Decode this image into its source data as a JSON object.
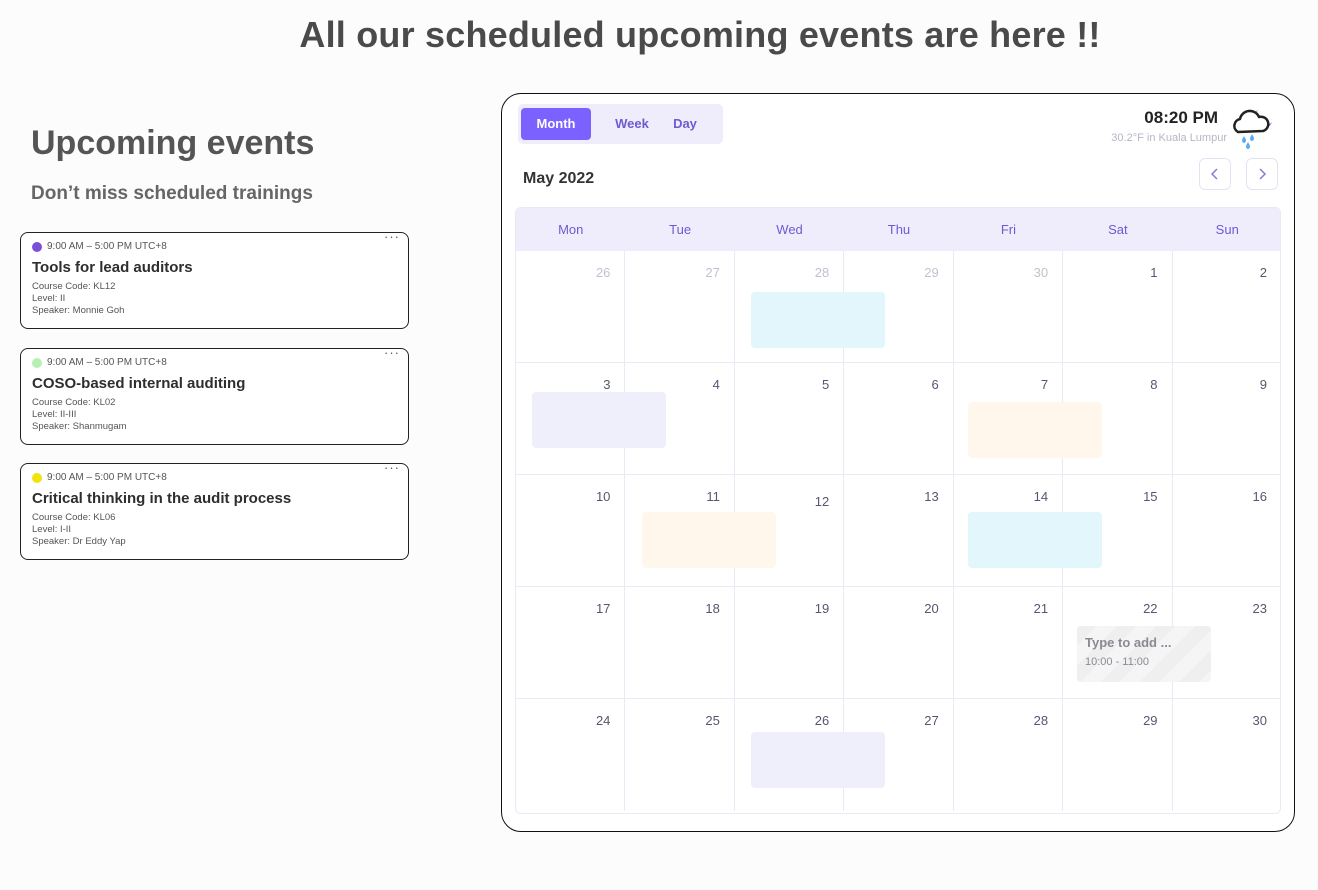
{
  "page": {
    "title": "All our scheduled upcoming events are here !!",
    "section_title": "Upcoming events",
    "section_subtitle": "Don’t miss scheduled trainings"
  },
  "events": [
    {
      "time": "9:00 AM – 5:00 PM UTC+8",
      "title": "Tools for lead auditors",
      "course_code": "Course Code: KL12",
      "level": "Level: II",
      "speaker": "Speaker: Monnie Goh",
      "dot_color": "#7b4fd8",
      "more": "···"
    },
    {
      "time": "9:00 AM – 5:00 PM UTC+8",
      "title": "COSO-based internal auditing",
      "course_code": "Course Code: KL02",
      "level": "Level: II-III",
      "speaker": "Speaker: Shanmugam",
      "dot_color": "#b9efb4",
      "more": "···"
    },
    {
      "time": "9:00 AM – 5:00 PM UTC+8",
      "title": "Critical thinking in the audit process",
      "course_code": "Course Code: KL06",
      "level": "Level: I-II",
      "speaker": "Speaker: Dr Eddy Yap",
      "dot_color": "#f2e20d",
      "more": "···"
    }
  ],
  "calendar": {
    "views": [
      "Month",
      "Week",
      "Day"
    ],
    "active_view": "Month",
    "time": "08:20 PM",
    "weather": "30.2°F in Kuala Lumpur",
    "weather_icon": "cloud-rain-moon-icon",
    "month": "May 2022",
    "weekdays": [
      "Mon",
      "Tue",
      "Wed",
      "Thu",
      "Fri",
      "Sat",
      "Sun"
    ],
    "weeks": [
      [
        "26",
        "27",
        "28",
        "29",
        "30",
        "1",
        "2"
      ],
      [
        "3",
        "4",
        "5",
        "6",
        "7",
        "8",
        "9"
      ],
      [
        "10",
        "11",
        "12",
        "13",
        "14",
        "15",
        "16"
      ],
      [
        "17",
        "18",
        "19",
        "20",
        "21",
        "22",
        "23"
      ],
      [
        "24",
        "25",
        "26",
        "27",
        "28",
        "29",
        "30"
      ]
    ],
    "draft_event": {
      "placeholder": "Type to add ...",
      "time": "10:00 - 11:00"
    },
    "colors": {
      "accent": "#7b61ff",
      "cyan": "#e3f6fb",
      "lavender": "#efeefb",
      "peach": "#fff6ec"
    }
  }
}
